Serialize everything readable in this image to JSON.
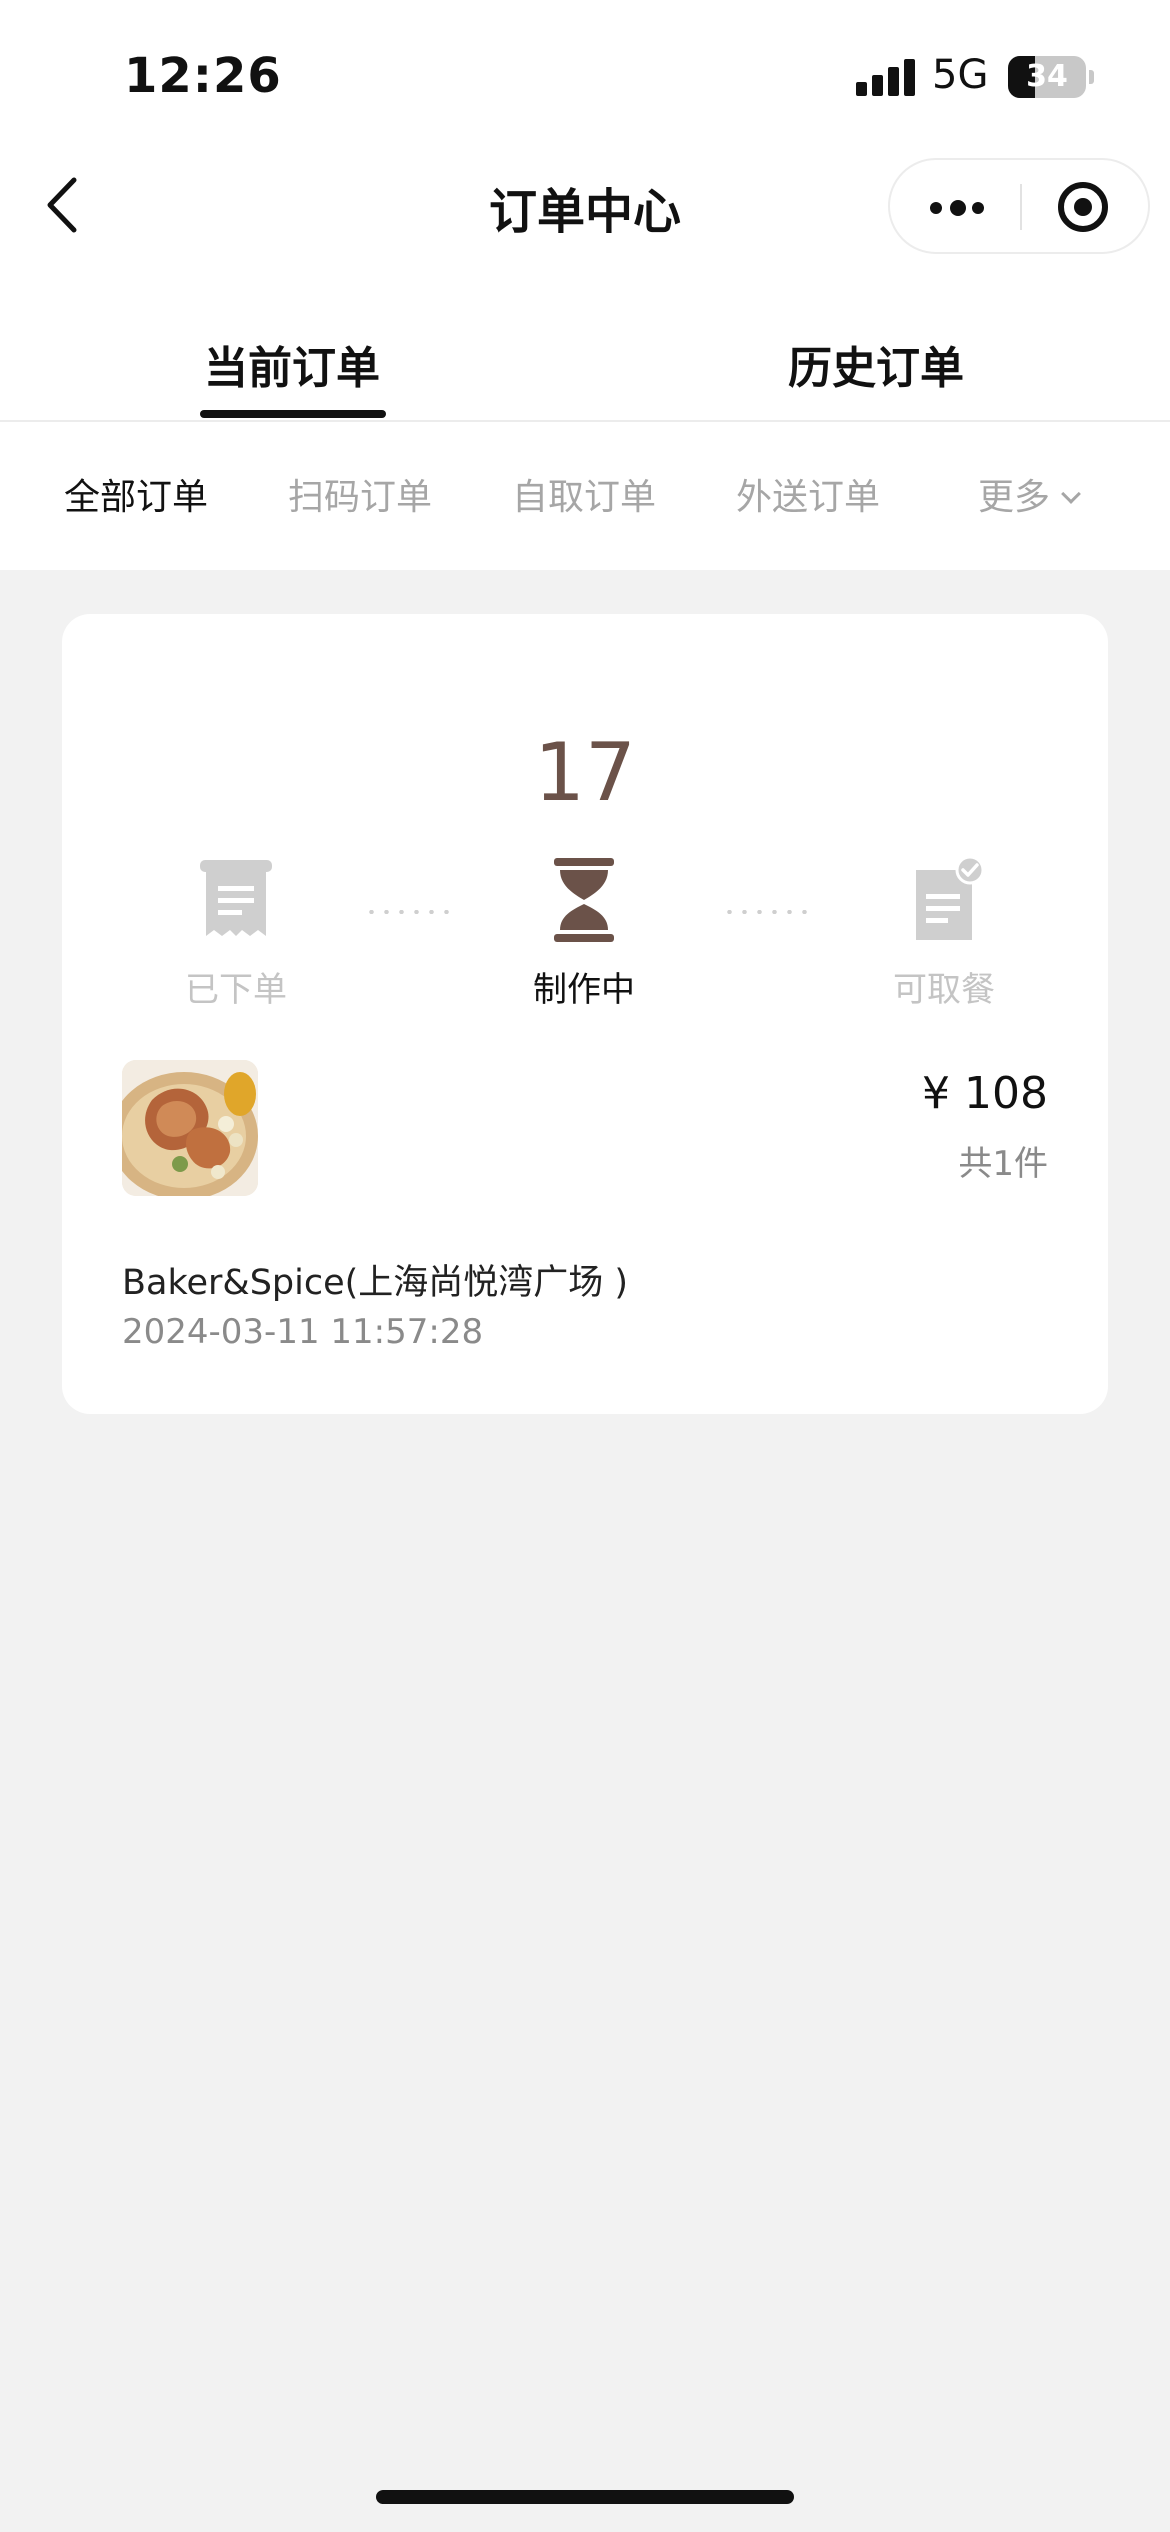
{
  "status_bar": {
    "time": "12:26",
    "network": "5G",
    "battery": "34",
    "battery_level_percent": 34
  },
  "nav": {
    "title": "订单中心"
  },
  "tabs": {
    "current": "当前订单",
    "history": "历史订单",
    "active": "current"
  },
  "sub_tabs": [
    {
      "label": "全部订单",
      "active": true
    },
    {
      "label": "扫码订单",
      "active": false
    },
    {
      "label": "自取订单",
      "active": false
    },
    {
      "label": "外送订单",
      "active": false
    },
    {
      "label": "更多",
      "active": false
    }
  ],
  "order": {
    "queue_number": "17",
    "steps": [
      {
        "label": "已下单",
        "icon": "receipt-icon",
        "active": false
      },
      {
        "label": "制作中",
        "icon": "hourglass-icon",
        "active": true
      },
      {
        "label": "可取餐",
        "icon": "document-check-icon",
        "active": false
      }
    ],
    "price": "¥ 108",
    "item_count": "共1件",
    "store_name": "Baker&Spice(上海尚悦湾广场 )",
    "time": "2024-03-11 11:57:28"
  },
  "colors": {
    "accent_brown": "#6b5249",
    "inactive_gray": "#c4c4c4",
    "background": "#f2f2f2"
  }
}
